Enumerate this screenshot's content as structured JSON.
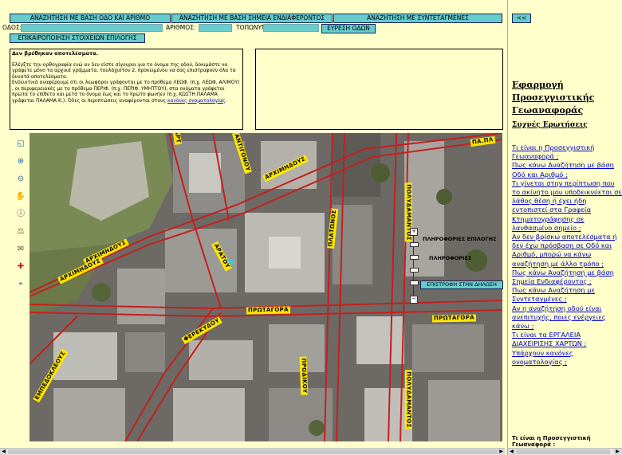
{
  "search_tabs": [
    {
      "label": "ΑΝΑΖΗΤΗΣΗ ΜΕ ΒΑΣΗ ΟΔΟ ΚΑΙ ΑΡΙΘΜΟ"
    },
    {
      "label": "ΑΝΑΖΗΤΗΣΗ ΜΕ ΒΑΣΗ ΣΗΜΕΙΑ ΕΝΔΙΑΦΕΡΟΝΤΟΣ"
    },
    {
      "label": "ΑΝΑΖΗΤΗΣΗ ΜΕ ΣΥΝΤΕΤΑΓΜΕΝΕΣ"
    }
  ],
  "collapse_button": "<<",
  "form": {
    "street_label": "ΟΔΟΣ:",
    "street_value": "",
    "number_label": "ΑΡΙΘΜΟΣ:",
    "number_value": "",
    "place_label": "ΤΟΠΩΝΥΜΙΟ:",
    "place_value": "",
    "find_button": "ΕΥΡΕΣΗ ΟΔΩΝ",
    "verify_button": "ΕΠΙΚΑΙΡΟΠΟΙΗΣΗ ΣΤΟΙΧΕΙΩΝ ΕΠΙΛΟΓΗΣ"
  },
  "results": {
    "heading": "Δεν βρέθηκαν αποτελέσματα.",
    "p1": "Ελέγξτε την ορθογραφία ενώ αν δεν είστε σίγουροι για το όνομα της οδού, δοκιμάστε να γράψετε μόνο τα αρχικά γράμματα, τουλάχιστον 2, προκειμένου να σας επιστραφούν όλα τα δυνατά αποτελέσματα.",
    "p2": "Ενδεικτικά αναφέρουμε ότι οι λεωφόροι γράφονται με το πρόθεμα ΛΕΩΦ. (π.χ. ΛΕΩΦ. ΑΛΙΜΟΥ) , οι περιφερειακές με το πρόθεμα ΠΕΡΙΦ. (π.χ. ΠΕΡΙΦ. ΥΜΗΤΤΟΥ), στα ονόματα γράφεται πρώτα το επίθετο και μετά το όνομα έως και το πρώτο φωνήεν (π.χ. ΚΩΣΤΗ ΠΑΛΑΜΑ γράφεται ΠΑΛΑΜΑ Κ.). Όλες οι περιπτώσεις αναφέρονται στους",
    "link": "κανόνες ονοματολογίας",
    "tail": "."
  },
  "map": {
    "streets": [
      {
        "name": "ΑΡΧΙΜΗΔΟΥΣ"
      },
      {
        "name": "ΑΡΧΙΜΗΔΟΥΣ"
      },
      {
        "name": "ΑΡΧΙΜΗΔΟΥΣ"
      },
      {
        "name": "ΑΝΤΙΓΟΝΟΥ"
      },
      {
        "name": "ΠΛΑΤΩΝΟΣ"
      },
      {
        "name": "ΠΑ.ΠΛ"
      },
      {
        "name": "ΑΡΑΤΟΥ"
      },
      {
        "name": "ΠΡΩΤΑΓΟΡΑ"
      },
      {
        "name": "ΠΡΩΤΑΓΟΡΑ"
      },
      {
        "name": "ΦΕΡΕΚΥΔΟΥ"
      },
      {
        "name": "ΕΜΠΕΔΟΚΛΕΟΥΣ"
      },
      {
        "name": "ΠΟΛΥΔΑΜΑΝΤΟΣ"
      },
      {
        "name": "ΠΟΛΥΔΑΜΑΝΤΟΣ"
      },
      {
        "name": "ΠΡΟΔΙΚΟΥ"
      },
      {
        "name": "ΑΡΤ"
      }
    ],
    "legend": {
      "selection_info": "ΠΛΗΡΟΦΟΡΙΕΣ ΕΠΙΛΟΓΗΣ",
      "info": "ΠΛΗΡΟΦΟΡΙΕΣ",
      "return_button": "ΕΠΙΣΤΡΟΦΗ ΣΤΗΝ ΔΗΛΩΣΗ"
    },
    "tools": [
      {
        "name": "overview-icon",
        "glyph": "◱"
      },
      {
        "name": "zoom-in-icon",
        "glyph": "⊕"
      },
      {
        "name": "zoom-out-icon",
        "glyph": "⊖"
      },
      {
        "name": "pan-hand-icon",
        "glyph": "✋"
      },
      {
        "name": "info-icon",
        "glyph": "ⓘ"
      },
      {
        "name": "measure-icon",
        "glyph": "⚖"
      },
      {
        "name": "mail-icon",
        "glyph": "✉"
      },
      {
        "name": "pin-icon",
        "glyph": "✚"
      },
      {
        "name": "locate-icon",
        "glyph": "⌖"
      }
    ]
  },
  "sidebar": {
    "title": "Εφαρμογή Προσεγγιστικής Γεωαναφοράς",
    "faq_heading": "Συχνές Ερωτήσεις",
    "faq": [
      "Τι είναι η Προσεγγιστική Γεωαναφορά ;",
      "Πως κάνω Αναζήτηση με βάση Οδό και Αριθμό ;",
      "Τι γίνεται στην περίπτωση που το ακίνητο μου υποδεικνύεται σε λάθος θέση ή έχει ήδη εντοπιστεί στα Γραφεία Κτηματογράφησης σε λανθασμένο σημείο ;",
      "Αν δεν βρίσκω αποτελέσματα ή δεν έχω πρόσβαση σε Οδό και Αριθμό, μπορώ να κάνω αναζήτηση με άλλο τρόπο ;",
      "Πως κάνω Αναζήτηση με βάση Σημεία Ενδιαφέροντος ;",
      "Πως κάνω Αναζήτηση με Συντεταγμένες ;",
      "Αν η αναζήτηση οδού είναι ανεπιτυχής, ποιες ενέργειες κάνω ;",
      "Τι είναι τα ΕΡΓΑΛΕΙΑ ΔΙΑΧΕΙΡΙΣΗΣ ΧΑΡΤΩΝ ;",
      "Υπάρχουν κανόνες ονοματολογίας ;"
    ],
    "answer_title": "Τι είναι η Προσεγγιστική Γεωαναφορά :"
  }
}
